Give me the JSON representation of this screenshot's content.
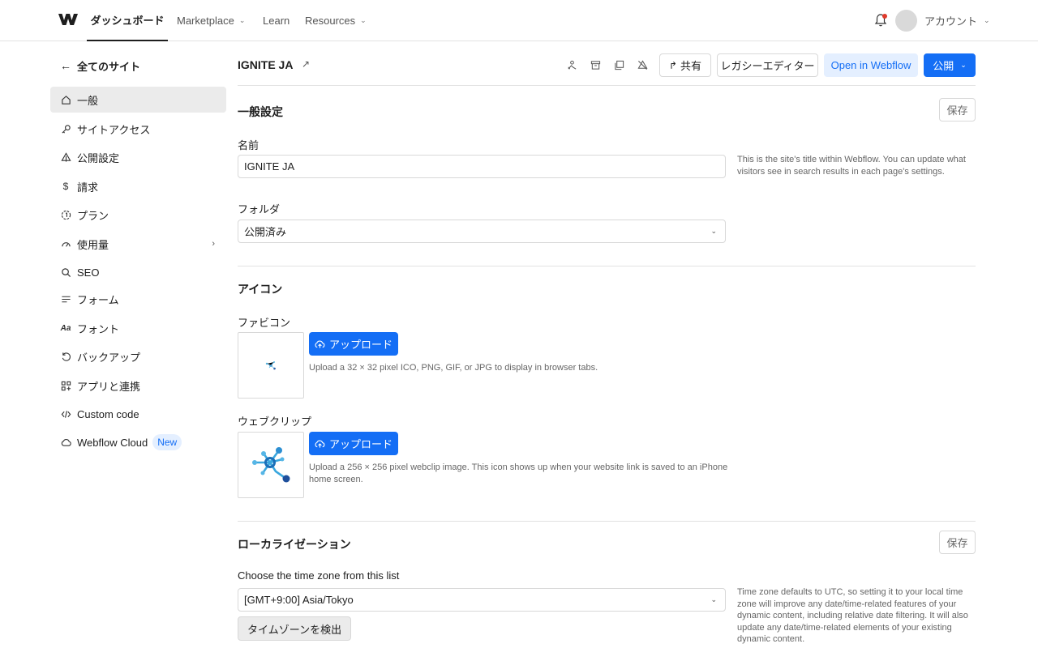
{
  "topnav": {
    "dashboard": "ダッシュボード",
    "marketplace": "Marketplace",
    "learn": "Learn",
    "resources": "Resources",
    "account": "アカウント"
  },
  "sidebar": {
    "back": "全てのサイト",
    "items": [
      {
        "label": "一般",
        "icon": "home-icon"
      },
      {
        "label": "サイトアクセス",
        "icon": "key-icon"
      },
      {
        "label": "公開設定",
        "icon": "publish-icon"
      },
      {
        "label": "請求",
        "icon": "dollar-icon"
      },
      {
        "label": "プラン",
        "icon": "plan-icon"
      },
      {
        "label": "使用量",
        "icon": "gauge-icon"
      },
      {
        "label": "SEO",
        "icon": "search-icon"
      },
      {
        "label": "フォーム",
        "icon": "form-icon"
      },
      {
        "label": "フォント",
        "icon": "font-icon"
      },
      {
        "label": "バックアップ",
        "icon": "backup-icon"
      },
      {
        "label": "アプリと連携",
        "icon": "apps-icon"
      },
      {
        "label": "Custom code",
        "icon": "code-icon"
      },
      {
        "label": "Webflow Cloud",
        "icon": "cloud-icon",
        "badge": "New"
      }
    ]
  },
  "header": {
    "site_title": "IGNITE JA",
    "share": "共有",
    "legacy_editor": "レガシーエディター",
    "open_in_webflow": "Open in Webflow",
    "publish": "公開"
  },
  "general": {
    "title": "一般設定",
    "save": "保存",
    "name_label": "名前",
    "name_value": "IGNITE JA",
    "name_help": "This is the site's title within Webflow. You can update what visitors see in search results in each page's settings.",
    "folder_label": "フォルダ",
    "folder_value": "公開済み"
  },
  "icons": {
    "title": "アイコン",
    "favicon_label": "ファビコン",
    "upload": "アップロード",
    "favicon_help": "Upload a 32 × 32 pixel ICO, PNG, GIF, or JPG to display in browser tabs.",
    "webclip_label": "ウェブクリップ",
    "webclip_help": "Upload a 256 × 256 pixel webclip image. This icon shows up when your website link is saved to an iPhone home screen."
  },
  "localization": {
    "title": "ローカライゼーション",
    "save": "保存",
    "timezone_label": "Choose the time zone from this list",
    "timezone_value": "[GMT+9:00] Asia/Tokyo",
    "timezone_help": "Time zone defaults to UTC, so setting it to your local time zone will improve any date/time-related features of your dynamic content, including relative date filtering. It will also update any date/time-related elements of your existing dynamic content.",
    "detect": "タイムゾーンを検出"
  },
  "colors": {
    "accent": "#146ef5",
    "accent_light": "#e4efff",
    "active_bg": "#ebebeb",
    "notification": "#e0392b"
  }
}
